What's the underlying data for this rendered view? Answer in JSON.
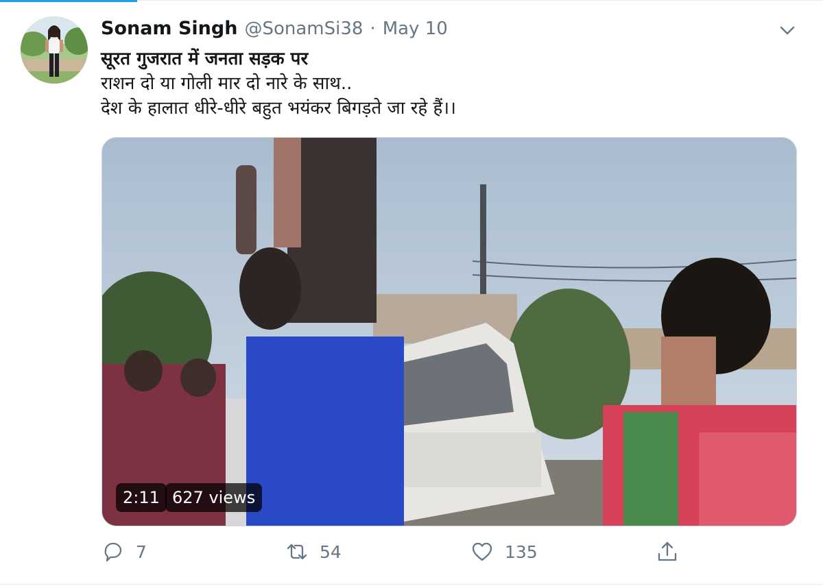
{
  "tweet": {
    "author": {
      "display_name": "Sonam Singh",
      "handle": "@SonamSi38"
    },
    "separator": "·",
    "date": "May 10",
    "text_lines": [
      "सूरत गुजरात में जनता सड़क पर",
      "राशन दो या गोली मार दो नारे के साथ..",
      "देश के हालात धीरे-धीरे बहुत भयंकर बिगड़ते जा रहे हैं।।"
    ],
    "media": {
      "duration": "2:11",
      "views": "627 views"
    },
    "actions": {
      "reply_count": "7",
      "retweet_count": "54",
      "like_count": "135"
    }
  },
  "colors": {
    "accent": "#1da1f2",
    "text_primary": "#14171a",
    "text_secondary": "#657786",
    "border": "#ccd6dd"
  },
  "icons": {
    "menu": "chevron-down-icon",
    "reply": "reply-icon",
    "retweet": "retweet-icon",
    "like": "heart-icon",
    "share": "share-icon"
  }
}
